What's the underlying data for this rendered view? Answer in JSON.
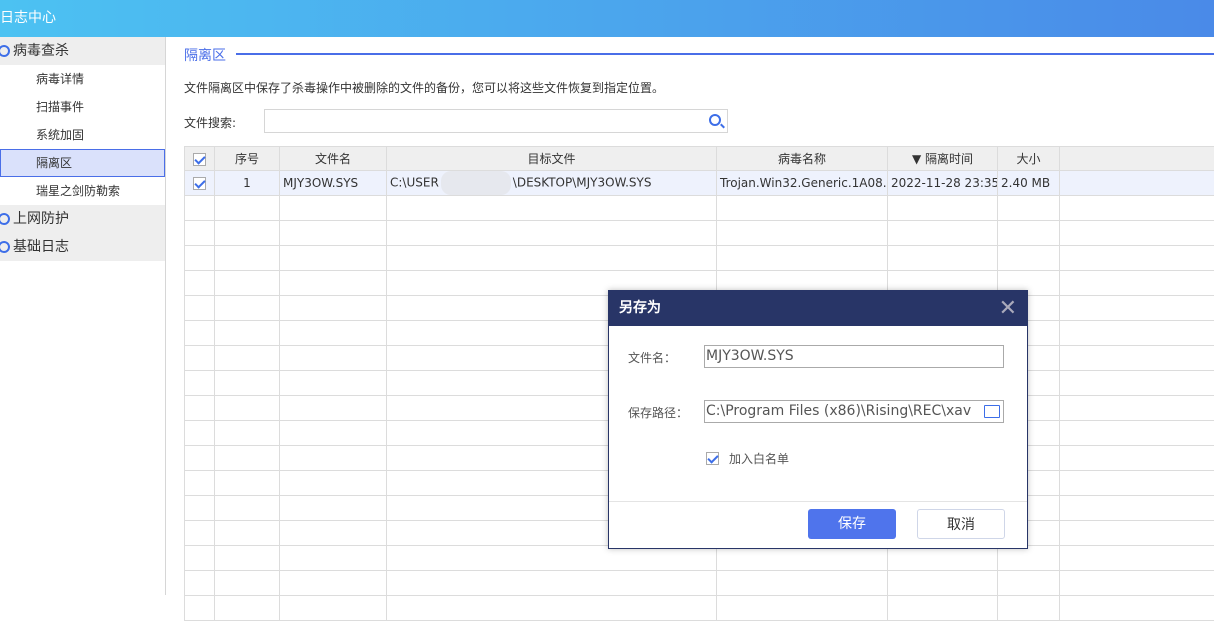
{
  "window": {
    "title": "日志中心"
  },
  "sidebar": {
    "sections": [
      {
        "label": "病毒查杀",
        "items": [
          "病毒详情",
          "扫描事件",
          "系统加固",
          "隔离区",
          "瑞星之剑防勒索"
        ]
      },
      {
        "label": "上网防护"
      },
      {
        "label": "基础日志"
      }
    ],
    "active": "隔离区"
  },
  "main": {
    "title": "隔离区",
    "description": "文件隔离区中保存了杀毒操作中被删除的文件的备份，您可以将这些文件恢复到指定位置。",
    "search_label": "文件搜索:",
    "search_value": "",
    "table": {
      "headers": [
        "序号",
        "文件名",
        "目标文件",
        "病毒名称",
        "▼ 隔离时间",
        "大小"
      ],
      "rows": [
        {
          "checked": true,
          "index": "1",
          "file": "MJY3OW.SYS",
          "target_prefix": "C:\\USER",
          "target_suffix": "\\DESKTOP\\MJY3OW.SYS",
          "virus": "Trojan.Win32.Generic.1A08...",
          "time": "2022-11-28 23:35",
          "size": "2.40 MB"
        }
      ]
    }
  },
  "dialog": {
    "title": "另存为",
    "filename_label": "文件名：",
    "filename_value": "MJY3OW.SYS",
    "path_label": "保存路径：",
    "path_value": "C:\\Program Files (x86)\\Rising\\REC\\xav",
    "whitelist_label": "加入白名单",
    "whitelist_checked": true,
    "save_label": "保存",
    "cancel_label": "取消"
  }
}
